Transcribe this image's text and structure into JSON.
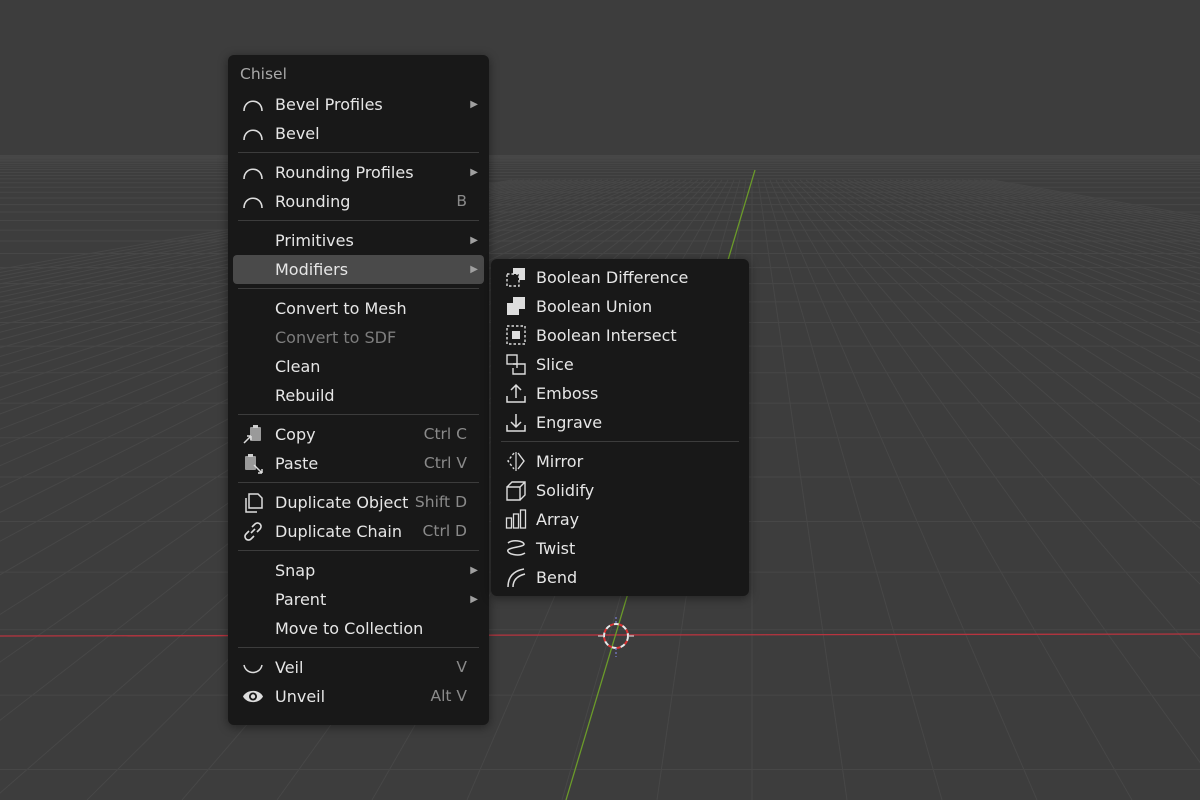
{
  "main_menu": {
    "title": "Chisel",
    "items": [
      {
        "label": "Bevel Profiles",
        "icon": "arc-icon",
        "arrow": "▶"
      },
      {
        "label": "Bevel",
        "icon": "arc-icon"
      },
      {
        "label": "Rounding Profiles",
        "icon": "arc-icon",
        "arrow": "▶"
      },
      {
        "label": "Rounding",
        "icon": "arc-icon",
        "shortcut": "B"
      },
      {
        "label": "Primitives",
        "arrow": "▶"
      },
      {
        "label": "Modifiers",
        "arrow": "▶",
        "highlighted": true
      },
      {
        "label": "Convert to Mesh"
      },
      {
        "label": "Convert to SDF",
        "disabled": true
      },
      {
        "label": "Clean"
      },
      {
        "label": "Rebuild"
      },
      {
        "label": "Copy",
        "icon": "copy-icon",
        "shortcut": "Ctrl C"
      },
      {
        "label": "Paste",
        "icon": "paste-icon",
        "shortcut": "Ctrl V"
      },
      {
        "label": "Duplicate Object",
        "icon": "duplicate-icon",
        "shortcut": "Shift D"
      },
      {
        "label": "Duplicate Chain",
        "icon": "link-icon",
        "shortcut": "Ctrl D"
      },
      {
        "label": "Snap",
        "arrow": "▶"
      },
      {
        "label": "Parent",
        "arrow": "▶"
      },
      {
        "label": "Move to Collection"
      },
      {
        "label": "Veil",
        "icon": "veil-icon",
        "shortcut": "V"
      },
      {
        "label": "Unveil",
        "icon": "eye-icon",
        "shortcut": "Alt V"
      }
    ]
  },
  "sub_menu": {
    "items": [
      {
        "label": "Boolean Difference",
        "icon": "boolean-difference-icon"
      },
      {
        "label": "Boolean Union",
        "icon": "boolean-union-icon"
      },
      {
        "label": "Boolean Intersect",
        "icon": "boolean-intersect-icon"
      },
      {
        "label": "Slice",
        "icon": "slice-icon"
      },
      {
        "label": "Emboss",
        "icon": "emboss-icon"
      },
      {
        "label": "Engrave",
        "icon": "engrave-icon"
      },
      {
        "label": "Mirror",
        "icon": "mirror-icon"
      },
      {
        "label": "Solidify",
        "icon": "solidify-icon"
      },
      {
        "label": "Array",
        "icon": "array-icon"
      },
      {
        "label": "Twist",
        "icon": "twist-icon"
      },
      {
        "label": "Bend",
        "icon": "bend-icon"
      }
    ]
  },
  "colors": {
    "background": "#3d3d3d",
    "grid": "#474747",
    "x_axis": "#b8343f",
    "y_axis": "#6b9a2a",
    "menu_bg": "#181818",
    "highlight": "#4a4a4a",
    "text": "#e6e6e6",
    "shortcut": "#8a8a8a"
  }
}
